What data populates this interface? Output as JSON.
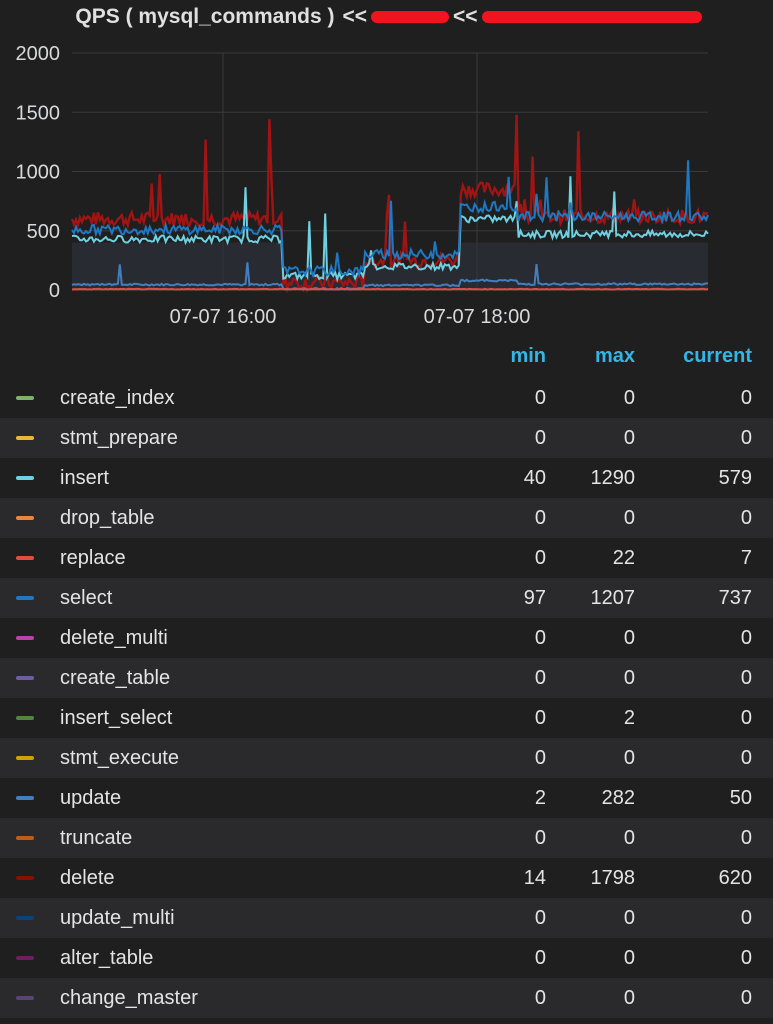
{
  "title": {
    "main": "QPS ( mysql_commands )",
    "sep1": "<<",
    "sep2": "<<"
  },
  "chart_data": {
    "type": "line",
    "ylim": [
      0,
      2000
    ],
    "y_ticks": [
      "0",
      "500",
      "1000",
      "1500",
      "2000"
    ],
    "x_ticks": [
      "07-07 16:00",
      "07-07 18:00"
    ],
    "grid": true,
    "series": [
      {
        "name": "delete",
        "color": "#a01414",
        "min": 14,
        "max": 1798,
        "current": 620
      },
      {
        "name": "insert",
        "color": "#6ed0e0",
        "min": 40,
        "max": 1290,
        "current": 579
      },
      {
        "name": "select",
        "color": "#1f78c1",
        "min": 97,
        "max": 1207,
        "current": 737
      },
      {
        "name": "update",
        "color": "#447ebc",
        "min": 2,
        "max": 282,
        "current": 50
      },
      {
        "name": "replace",
        "color": "#e24d42",
        "min": 0,
        "max": 22,
        "current": 7
      }
    ]
  },
  "legend": {
    "headers": {
      "min": "min",
      "max": "max",
      "current": "current"
    },
    "rows": [
      {
        "name": "create_index",
        "color": "#7eb26d",
        "min": "0",
        "max": "0",
        "current": "0"
      },
      {
        "name": "stmt_prepare",
        "color": "#eab839",
        "min": "0",
        "max": "0",
        "current": "0"
      },
      {
        "name": "insert",
        "color": "#6ed0e0",
        "min": "40",
        "max": "1290",
        "current": "579"
      },
      {
        "name": "drop_table",
        "color": "#ef843c",
        "min": "0",
        "max": "0",
        "current": "0"
      },
      {
        "name": "replace",
        "color": "#e24d42",
        "min": "0",
        "max": "22",
        "current": "7"
      },
      {
        "name": "select",
        "color": "#1f78c1",
        "min": "97",
        "max": "1207",
        "current": "737"
      },
      {
        "name": "delete_multi",
        "color": "#ba43a9",
        "min": "0",
        "max": "0",
        "current": "0"
      },
      {
        "name": "create_table",
        "color": "#705da0",
        "min": "0",
        "max": "0",
        "current": "0"
      },
      {
        "name": "insert_select",
        "color": "#508642",
        "min": "0",
        "max": "2",
        "current": "0"
      },
      {
        "name": "stmt_execute",
        "color": "#cca300",
        "min": "0",
        "max": "0",
        "current": "0"
      },
      {
        "name": "update",
        "color": "#447ebc",
        "min": "2",
        "max": "282",
        "current": "50"
      },
      {
        "name": "truncate",
        "color": "#c15c17",
        "min": "0",
        "max": "0",
        "current": "0"
      },
      {
        "name": "delete",
        "color": "#890f02",
        "min": "14",
        "max": "1798",
        "current": "620"
      },
      {
        "name": "update_multi",
        "color": "#0a437c",
        "min": "0",
        "max": "0",
        "current": "0"
      },
      {
        "name": "alter_table",
        "color": "#6d1f62",
        "min": "0",
        "max": "0",
        "current": "0"
      },
      {
        "name": "change_master",
        "color": "#584477",
        "min": "0",
        "max": "0",
        "current": "0"
      }
    ]
  }
}
